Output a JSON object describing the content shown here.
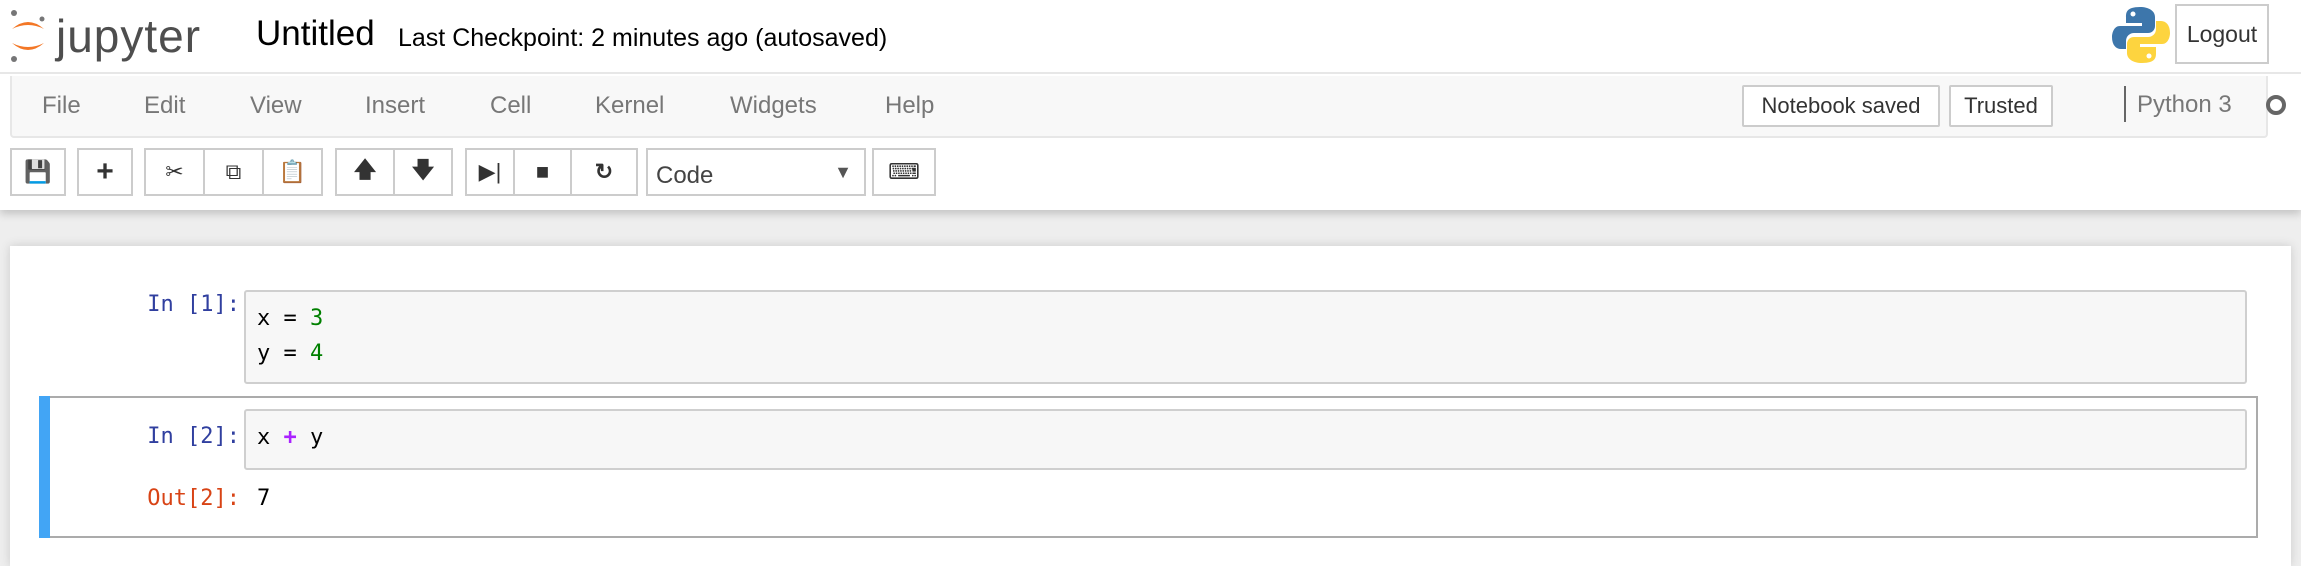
{
  "header": {
    "logo_text": "jupyter",
    "notebook_title": "Untitled",
    "checkpoint": "Last Checkpoint: 2 minutes ago (autosaved)",
    "logout_label": "Logout"
  },
  "menubar": {
    "items": [
      "File",
      "Edit",
      "View",
      "Insert",
      "Cell",
      "Kernel",
      "Widgets",
      "Help"
    ],
    "notification": "Notebook saved",
    "trusted": "Trusted",
    "kernel": "Python 3",
    "kernel_status": "idle"
  },
  "toolbar": {
    "buttons": [
      "save-icon",
      "plus-icon",
      "cut-icon",
      "copy-icon",
      "paste-icon",
      "arrow-up-icon",
      "arrow-down-icon",
      "step-forward-icon",
      "stop-icon",
      "refresh-icon",
      "keyboard-icon"
    ],
    "cell_type": "Code"
  },
  "cells": [
    {
      "prompt": "In [1]:",
      "lines": [
        [
          "x",
          "=",
          "3"
        ],
        [
          "y",
          "=",
          "4"
        ]
      ]
    },
    {
      "prompt": "In [2]:",
      "code": [
        "x",
        "+",
        "y"
      ],
      "out_prompt": "Out[2]:",
      "output": "7"
    }
  ],
  "colors": {
    "selected_bar": "#42a5f5",
    "in_prompt": "#303f9f",
    "out_prompt": "#d84315",
    "number": "#008000",
    "operator": "#aa22ff"
  }
}
